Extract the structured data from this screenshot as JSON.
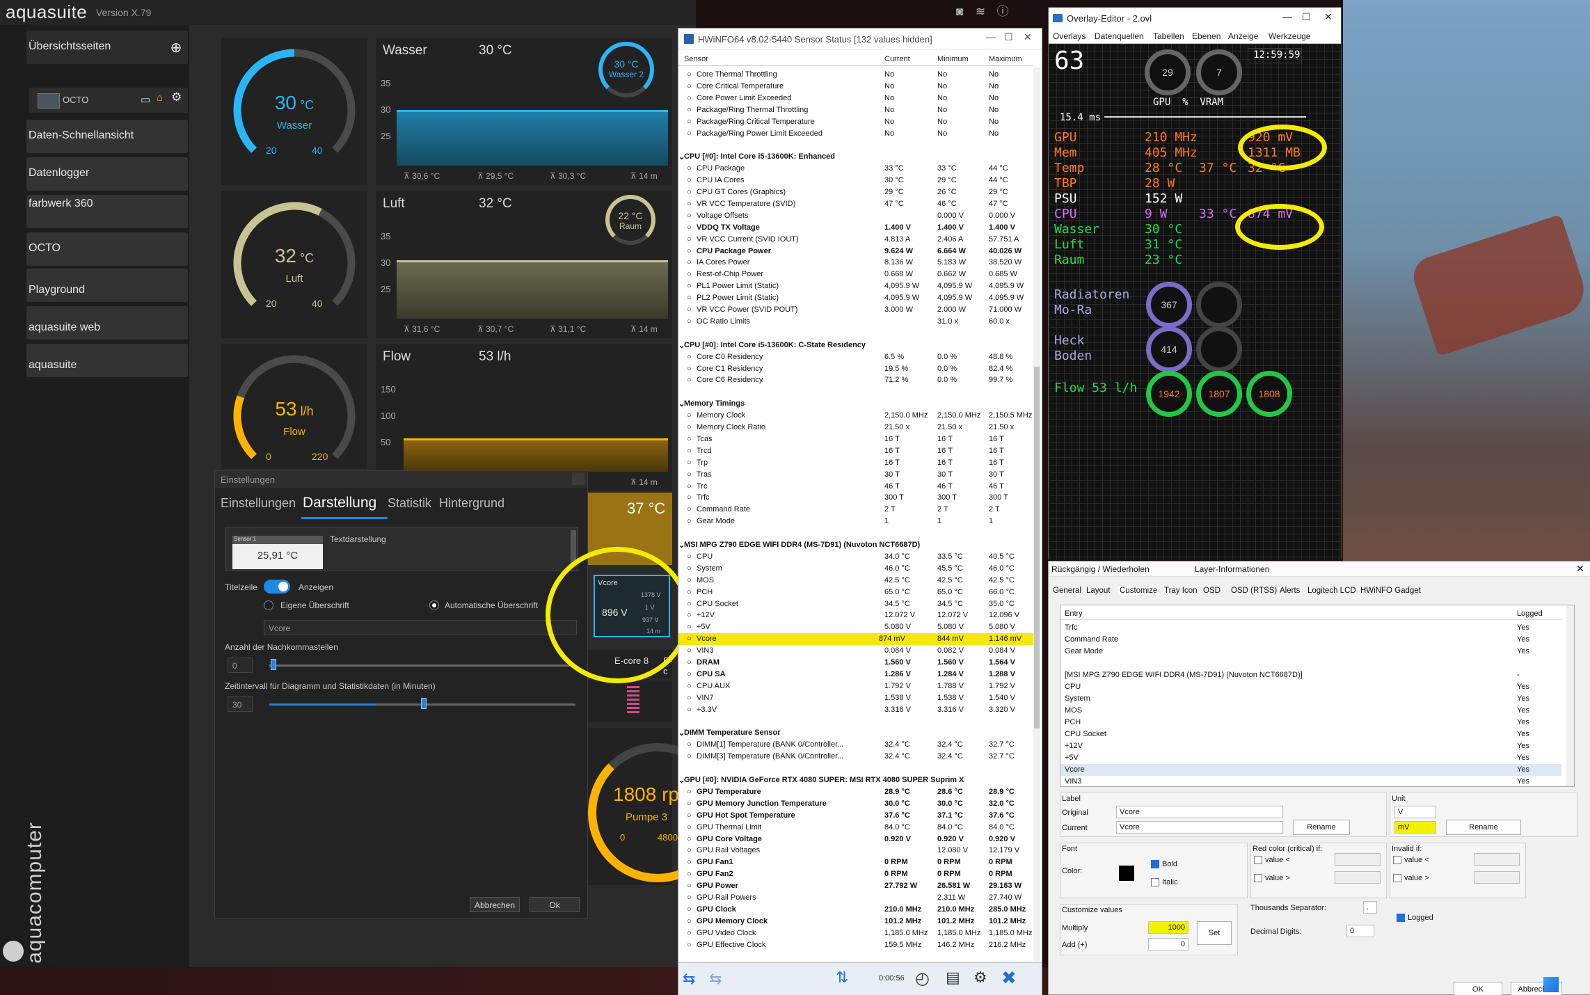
{
  "aquasuite": {
    "logo": "aquasuite",
    "version": "Version X.79",
    "brand": "aquacomputer",
    "sidebar": {
      "overview_label": "Übersichtsseiten",
      "sub_item": "OCTO",
      "items": [
        "Daten-Schnellansicht",
        "Datenlogger",
        "farbwerk 360",
        "OCTO",
        "Playground",
        "aquasuite web",
        "aquasuite"
      ]
    },
    "gauges": [
      {
        "value": "30",
        "unit": "°C",
        "label": "Wasser",
        "min": "20",
        "max": "40",
        "fraction": 0.5,
        "color": "#29b6f6"
      },
      {
        "value": "32",
        "unit": "°C",
        "label": "Luft",
        "min": "20",
        "max": "40",
        "fraction": 0.6,
        "color": "#c8c492"
      },
      {
        "value": "53",
        "unit": "l/h",
        "label": "Flow",
        "min": "0",
        "max": "220",
        "fraction": 0.24,
        "color": "#ffb300"
      }
    ],
    "charts": [
      {
        "title": "Wasser",
        "current": "30 °C",
        "mini_val": "30 °C",
        "mini_lbl": "Wasser 2",
        "yticks": [
          "35",
          "30",
          "25"
        ],
        "stats": [
          "⊼ 30,6 °C",
          "⊼ 29,5 °C",
          "⊼ 30,3 °C",
          "⊼ 14 m"
        ],
        "color": "#29b6f6"
      },
      {
        "title": "Luft",
        "current": "32 °C",
        "mini_val": "22 °C",
        "mini_lbl": "Raum",
        "yticks": [
          "35",
          "30",
          "25"
        ],
        "stats": [
          "⊼ 31,6 °C",
          "⊼ 30,7 °C",
          "⊼ 31,1 °C",
          "⊼ 14 m"
        ],
        "color": "#c8c492"
      },
      {
        "title": "Flow",
        "current": "53 l/h",
        "yticks": [
          "150",
          "100",
          "50"
        ],
        "stats": [
          "⊼ 14 m"
        ],
        "color": "#ffb300"
      }
    ],
    "pump": {
      "value": "1808",
      "unit": "rpm",
      "label": "Pumpe 3",
      "min": "0",
      "max": "4800"
    },
    "partial": {
      "temp": "37 °C",
      "ecore": "E-core 8",
      "ecore2": "E-c"
    },
    "vcore_tile": {
      "title": "Vcore",
      "value": "896 V",
      "max": "1378 V",
      "avg": "1 V",
      "min": "937 V",
      "time": "14 m"
    }
  },
  "settings_dialog": {
    "title": "Einstellungen",
    "tabs": [
      "Einstellungen",
      "Darstellung",
      "Statistik",
      "Hintergrund"
    ],
    "preview_header": "Sensor 1",
    "preview_value": "25,91 °C",
    "text_mode": "Textdarstellung",
    "title_row": "Titelzeile",
    "show": "Anzeigen",
    "own_title": "Eigene Überschrift",
    "auto_title": "Automatische Überschrift",
    "title_input": "Vcore",
    "decimals_label": "Anzahl der Nachkommastellen",
    "decimals_value": "0",
    "interval_label": "Zeitintervall für Diagramm und Statistikdaten (in Minuten)",
    "interval_value": "30",
    "cancel": "Abbrechen",
    "ok": "Ok"
  },
  "hwinfo": {
    "title": "HWiNFO64 v8.02-5440 Sensor Status [132 values hidden]",
    "columns": [
      "Sensor",
      "Current",
      "Minimum",
      "Maximum"
    ],
    "rows": [
      [
        "Core Thermal Throttling",
        "No",
        "No",
        "No"
      ],
      [
        "Core Critical Temperature",
        "No",
        "No",
        "No"
      ],
      [
        "Core Power Limit Exceeded",
        "No",
        "No",
        "No"
      ],
      [
        "Package/Ring Thermal Throttling",
        "No",
        "No",
        "No"
      ],
      [
        "Package/Ring Critical Temperature",
        "No",
        "No",
        "No"
      ],
      [
        "Package/Ring Power Limit Exceeded",
        "No",
        "No",
        "No"
      ],
      [
        "",
        "",
        "",
        ""
      ],
      [
        "CPU [#0]: Intel Core i5-13600K: Enhanced",
        "",
        "",
        "",
        "s"
      ],
      [
        "CPU Package",
        "33 °C",
        "33 °C",
        "44 °C"
      ],
      [
        "CPU IA Cores",
        "30 °C",
        "29 °C",
        "44 °C"
      ],
      [
        "CPU GT Cores (Graphics)",
        "29 °C",
        "26 °C",
        "29 °C"
      ],
      [
        "VR VCC Temperature (SVID)",
        "47 °C",
        "46 °C",
        "47 °C"
      ],
      [
        "Voltage Offsets",
        "",
        "0.000 V",
        "0.000 V"
      ],
      [
        "VDDQ TX Voltage",
        "1.400 V",
        "1.400 V",
        "1.400 V",
        "b"
      ],
      [
        "VR VCC Current (SVID IOUT)",
        "4.813 A",
        "2.406 A",
        "57.751 A"
      ],
      [
        "CPU Package Power",
        "9.624 W",
        "6.664 W",
        "40.026 W",
        "b"
      ],
      [
        "IA Cores Power",
        "8.136 W",
        "5.183 W",
        "38.520 W"
      ],
      [
        "Rest-of-Chip Power",
        "0.668 W",
        "0.662 W",
        "0.685 W"
      ],
      [
        "PL1 Power Limit (Static)",
        "4,095.9 W",
        "4,095.9 W",
        "4,095.9 W"
      ],
      [
        "PL2 Power Limit (Static)",
        "4,095.9 W",
        "4,095.9 W",
        "4,095.9 W"
      ],
      [
        "VR VCC Power (SVID POUT)",
        "3.000 W",
        "2.000 W",
        "71.000 W"
      ],
      [
        "OC Ratio Limits",
        "",
        "31.0 x",
        "60.0 x"
      ],
      [
        "",
        "",
        "",
        ""
      ],
      [
        "CPU [#0]: Intel Core i5-13600K: C-State Residency",
        "",
        "",
        "",
        "s"
      ],
      [
        "Core C0 Residency",
        "6.5 %",
        "0.0 %",
        "48.8 %"
      ],
      [
        "Core C1 Residency",
        "19.5 %",
        "0.0 %",
        "82.4 %"
      ],
      [
        "Core C6 Residency",
        "71.2 %",
        "0.0 %",
        "99.7 %"
      ],
      [
        "",
        "",
        "",
        ""
      ],
      [
        "Memory Timings",
        "",
        "",
        "",
        "s"
      ],
      [
        "Memory Clock",
        "2,150.0 MHz",
        "2,150.0 MHz",
        "2,150.5 MHz"
      ],
      [
        "Memory Clock Ratio",
        "21.50 x",
        "21.50 x",
        "21.50 x"
      ],
      [
        "Tcas",
        "16 T",
        "16 T",
        "16 T"
      ],
      [
        "Trcd",
        "16 T",
        "16 T",
        "16 T"
      ],
      [
        "Trp",
        "16 T",
        "16 T",
        "16 T"
      ],
      [
        "Tras",
        "30 T",
        "30 T",
        "30 T"
      ],
      [
        "Trc",
        "46 T",
        "46 T",
        "46 T"
      ],
      [
        "Trfc",
        "300 T",
        "300 T",
        "300 T"
      ],
      [
        "Command Rate",
        "2 T",
        "2 T",
        "2 T"
      ],
      [
        "Gear Mode",
        "1",
        "1",
        "1"
      ],
      [
        "",
        "",
        "",
        ""
      ],
      [
        "MSI MPG Z790 EDGE WIFI DDR4 (MS-7D91) (Nuvoton NCT6687D)",
        "",
        "",
        "",
        "s"
      ],
      [
        "CPU",
        "34.0 °C",
        "33.5 °C",
        "40.5 °C"
      ],
      [
        "System",
        "46.0 °C",
        "45.5 °C",
        "46.0 °C"
      ],
      [
        "MOS",
        "42.5 °C",
        "42.5 °C",
        "42.5 °C"
      ],
      [
        "PCH",
        "65.0 °C",
        "65.0 °C",
        "66.0 °C"
      ],
      [
        "CPU Socket",
        "34.5 °C",
        "34.5 °C",
        "35.0 °C"
      ],
      [
        "+12V",
        "12.072 V",
        "12.072 V",
        "12.096 V"
      ],
      [
        "+5V",
        "5.080 V",
        "5.080 V",
        "5.080 V"
      ],
      [
        "Vcore",
        "874 mV",
        "844 mV",
        "1.146 mV",
        "h"
      ],
      [
        "VIN3",
        "0.084 V",
        "0.082 V",
        "0.084 V"
      ],
      [
        "DRAM",
        "1.560 V",
        "1.560 V",
        "1.564 V",
        "b"
      ],
      [
        "CPU SA",
        "1.286 V",
        "1.284 V",
        "1.288 V",
        "b"
      ],
      [
        "CPU AUX",
        "1.792 V",
        "1.788 V",
        "1.792 V"
      ],
      [
        "VIN7",
        "1.538 V",
        "1.538 V",
        "1.540 V"
      ],
      [
        "+3.3V",
        "3.316 V",
        "3.316 V",
        "3.320 V"
      ],
      [
        "",
        "",
        "",
        ""
      ],
      [
        "DIMM Temperature Sensor",
        "",
        "",
        "",
        "s"
      ],
      [
        "DIMM[1] Temperature (BANK 0/Controller...",
        "32.4 °C",
        "32.4 °C",
        "32.7 °C"
      ],
      [
        "DIMM[3] Temperature (BANK 0/Controller...",
        "32.4 °C",
        "32.4 °C",
        "32.7 °C"
      ],
      [
        "",
        "",
        "",
        ""
      ],
      [
        "GPU [#0]: NVIDIA GeForce RTX 4080 SUPER: MSI RTX 4080 SUPER Suprim X",
        "",
        "",
        "",
        "s"
      ],
      [
        "GPU Temperature",
        "28.9 °C",
        "28.6 °C",
        "28.9 °C",
        "b"
      ],
      [
        "GPU Memory Junction Temperature",
        "30.0 °C",
        "30.0 °C",
        "32.0 °C",
        "b"
      ],
      [
        "GPU Hot Spot Temperature",
        "37.6 °C",
        "37.1 °C",
        "37.6 °C",
        "b"
      ],
      [
        "GPU Thermal Limit",
        "84.0 °C",
        "84.0 °C",
        "84.0 °C"
      ],
      [
        "GPU Core Voltage",
        "0.920 V",
        "0.920 V",
        "0.920 V",
        "b"
      ],
      [
        "GPU Rail Voltages",
        "",
        "12.080 V",
        "12.179 V"
      ],
      [
        "GPU Fan1",
        "0 RPM",
        "0 RPM",
        "0 RPM",
        "b"
      ],
      [
        "GPU Fan2",
        "0 RPM",
        "0 RPM",
        "0 RPM",
        "b"
      ],
      [
        "GPU Power",
        "27.792 W",
        "26.581 W",
        "29.163 W",
        "b"
      ],
      [
        "GPU Rail Powers",
        "",
        "2.311 W",
        "27.740 W"
      ],
      [
        "GPU Clock",
        "210.0 MHz",
        "210.0 MHz",
        "285.0 MHz",
        "b"
      ],
      [
        "GPU Memory Clock",
        "101.2 MHz",
        "101.2 MHz",
        "101.2 MHz",
        "b"
      ],
      [
        "GPU Video Clock",
        "1,185.0 MHz",
        "1,185.0 MHz",
        "1,185.0 MHz"
      ],
      [
        "GPU Effective Clock",
        "159.5 MHz",
        "146.2 MHz",
        "216.2 MHz"
      ]
    ],
    "timer": "0:00:56"
  },
  "overlay": {
    "title": "Overlay-Editor - 2.ovl",
    "menu": [
      "Overlays",
      "Datenquellen",
      "Tabellen",
      "Ebenen",
      "Anzeige",
      "Werkzeuge"
    ],
    "fps": "63",
    "gpu_ring": "29",
    "vram_ring": "7",
    "ring_labels": "GPU  %  VRAM",
    "clock": "12:59:59",
    "frametime": "15.4 ms",
    "rows": [
      {
        "label": "GPU",
        "v1": "210 MHz",
        "v2": "",
        "v3": "920 mV"
      },
      {
        "label": "Mem",
        "v1": "405 MHz",
        "v2": "",
        "v3": "1311 MB"
      },
      {
        "label": "Temp",
        "v1": "28 °C",
        "v2": "37 °C",
        "v3": "32 °C"
      },
      {
        "label": "TBP",
        "v1": "28 W",
        "v2": "",
        "v3": ""
      },
      {
        "label": "PSU",
        "v1": "152 W",
        "v2": "",
        "v3": ""
      },
      {
        "label": "CPU",
        "v1": "9 W",
        "v2": "33 °C",
        "v3": "874 mV"
      },
      {
        "label": "Wasser",
        "v1": "30 °C",
        "v2": "",
        "v3": ""
      },
      {
        "label": "Luft",
        "v1": "31 °C",
        "v2": "",
        "v3": ""
      },
      {
        "label": "Raum",
        "v1": "23 °C",
        "v2": "",
        "v3": ""
      }
    ],
    "radiators_label": "Radiatoren\nMo-Ra",
    "radiators_val": "367",
    "heck_label": "Heck\nBoden",
    "heck_val": "414",
    "flow_label": "Flow 53 l/h",
    "flow_vals": [
      "1942",
      "1807",
      "1808"
    ]
  },
  "rt": {
    "undo": "Rückgängig / Wiederholen",
    "layer": "Layer-Informationen",
    "tabs": [
      "General",
      "Layout",
      "Customize",
      "Tray Icon",
      "OSD",
      "OSD (RTSS)",
      "Alerts",
      "Logitech LCD",
      "HWiNFO Gadget"
    ],
    "list_head": [
      "Entry",
      "Logged"
    ],
    "list": [
      [
        "Trfc",
        "Yes"
      ],
      [
        "Command Rate",
        "Yes"
      ],
      [
        "Gear Mode",
        "Yes"
      ],
      [
        "",
        ""
      ],
      [
        "[MSI MPG Z790 EDGE WIFI DDR4 (MS-7D91) (Nuvoton NCT6687D)]",
        "-"
      ],
      [
        "CPU",
        "Yes"
      ],
      [
        "System",
        "Yes"
      ],
      [
        "MOS",
        "Yes"
      ],
      [
        "PCH",
        "Yes"
      ],
      [
        "CPU Socket",
        "Yes"
      ],
      [
        "+12V",
        "Yes"
      ],
      [
        "+5V",
        "Yes"
      ],
      [
        "Vcore",
        "Yes"
      ],
      [
        "VIN3",
        "Yes"
      ]
    ],
    "label_group": "Label",
    "original": "Original",
    "original_val": "Vcore",
    "current": "Current",
    "current_val": "Vcore",
    "rename": "Rename",
    "unit_group": "Unit",
    "unit_orig": "V",
    "unit_cur": "mV",
    "font": "Font",
    "color": "Color:",
    "bold": "Bold",
    "italic": "Italic",
    "red_color": "Red color (critical) if:",
    "invalid": "Invalid if:",
    "value_lt": "value <",
    "value_gt": "value >",
    "customize_values": "Customize values",
    "multiply": "Multiply",
    "multiply_val": "1000",
    "add": "Add (+)",
    "add_val": "0",
    "set": "Set",
    "thousands": "Thousands Separator:",
    "thousands_val": ".",
    "decimal_digits": "Decimal Digits:",
    "decimal_val": "0",
    "logged": "Logged",
    "ok": "OK",
    "cancel": "Abbrechen"
  }
}
